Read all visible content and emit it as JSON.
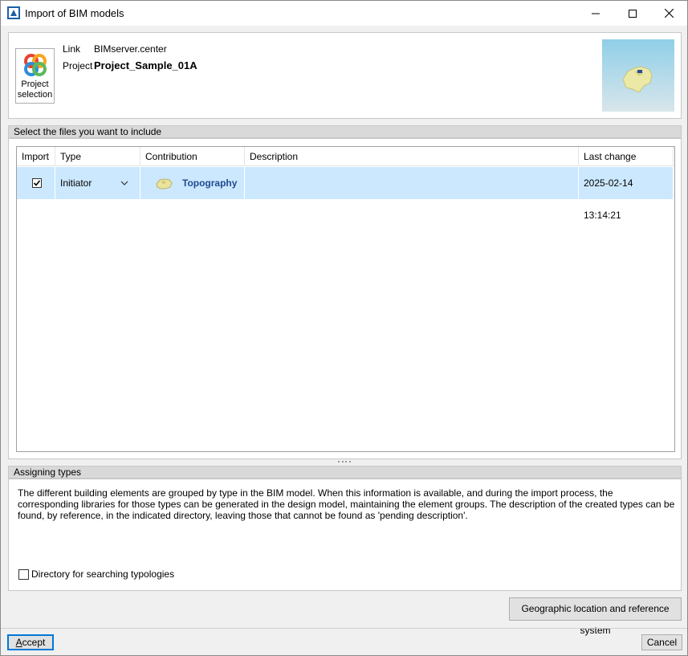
{
  "window": {
    "title": "Import of BIM models",
    "min_label": "Minimize",
    "max_label": "Maximize",
    "close_label": "Close"
  },
  "header": {
    "project_button_label_1": "Project",
    "project_button_label_2": "selection",
    "link_label": "Link",
    "link_value": "BIMserver.center",
    "project_label": "Project",
    "project_value": "Project_Sample_01A"
  },
  "files": {
    "section_title": "Select the files you want to include",
    "columns": [
      "Import",
      "Type",
      "Contribution",
      "Description",
      "Last change"
    ],
    "rows": [
      {
        "import": true,
        "type": "Initiator",
        "contribution": "Topography",
        "description": "",
        "last_change": "2025-02-14 13:14:21"
      }
    ]
  },
  "types": {
    "section_title": "Assigning types",
    "description": "The different building elements are grouped by type in the BIM model. When this information is available, and during the import process, the corresponding libraries for those types can be generated in the design model, maintaining the element groups. The description of the created types can be found, by reference, in the indicated directory, leaving those that cannot be found as 'pending description'.",
    "directory_checkbox_label": "Directory for searching typologies",
    "directory_checked": false
  },
  "buttons": {
    "geo": "Geographic location and reference system",
    "accept": "Accept",
    "cancel": "Cancel"
  },
  "colors": {
    "selected_row": "#cce8ff",
    "contribution_text": "#1f4a8f",
    "accept_border": "#0078d7"
  }
}
